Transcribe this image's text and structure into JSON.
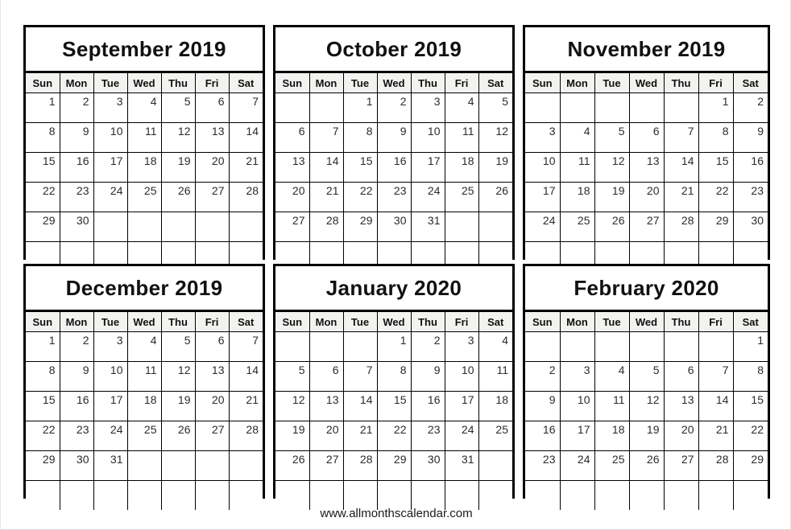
{
  "footer": {
    "url": "www.allmonthscalendar.com"
  },
  "weekday_headers": [
    "Sun",
    "Mon",
    "Tue",
    "Wed",
    "Thu",
    "Fri",
    "Sat"
  ],
  "colors": {
    "border": "#000000",
    "header_background": "#f2f2f0",
    "text": "#111111",
    "date_text": "#2b2b2b",
    "page_background": "#ffffff"
  },
  "months": [
    {
      "title": "September 2019",
      "name": "September",
      "year": "2019",
      "weeks": [
        [
          "1",
          "2",
          "3",
          "4",
          "5",
          "6",
          "7"
        ],
        [
          "8",
          "9",
          "10",
          "11",
          "12",
          "13",
          "14"
        ],
        [
          "15",
          "16",
          "17",
          "18",
          "19",
          "20",
          "21"
        ],
        [
          "22",
          "23",
          "24",
          "25",
          "26",
          "27",
          "28"
        ],
        [
          "29",
          "30",
          "",
          "",
          "",
          "",
          ""
        ],
        [
          "",
          "",
          "",
          "",
          "",
          "",
          ""
        ]
      ]
    },
    {
      "title": "October 2019",
      "name": "October",
      "year": "2019",
      "weeks": [
        [
          "",
          "",
          "1",
          "2",
          "3",
          "4",
          "5"
        ],
        [
          "6",
          "7",
          "8",
          "9",
          "10",
          "11",
          "12"
        ],
        [
          "13",
          "14",
          "15",
          "16",
          "17",
          "18",
          "19"
        ],
        [
          "20",
          "21",
          "22",
          "23",
          "24",
          "25",
          "26"
        ],
        [
          "27",
          "28",
          "29",
          "30",
          "31",
          "",
          ""
        ],
        [
          "",
          "",
          "",
          "",
          "",
          "",
          ""
        ]
      ]
    },
    {
      "title": "November 2019",
      "name": "November",
      "year": "2019",
      "weeks": [
        [
          "",
          "",
          "",
          "",
          "",
          "1",
          "2"
        ],
        [
          "3",
          "4",
          "5",
          "6",
          "7",
          "8",
          "9"
        ],
        [
          "10",
          "11",
          "12",
          "13",
          "14",
          "15",
          "16"
        ],
        [
          "17",
          "18",
          "19",
          "20",
          "21",
          "22",
          "23"
        ],
        [
          "24",
          "25",
          "26",
          "27",
          "28",
          "29",
          "30"
        ],
        [
          "",
          "",
          "",
          "",
          "",
          "",
          ""
        ]
      ]
    },
    {
      "title": "December 2019",
      "name": "December",
      "year": "2019",
      "weeks": [
        [
          "1",
          "2",
          "3",
          "4",
          "5",
          "6",
          "7"
        ],
        [
          "8",
          "9",
          "10",
          "11",
          "12",
          "13",
          "14"
        ],
        [
          "15",
          "16",
          "17",
          "18",
          "19",
          "20",
          "21"
        ],
        [
          "22",
          "23",
          "24",
          "25",
          "26",
          "27",
          "28"
        ],
        [
          "29",
          "30",
          "31",
          "",
          "",
          "",
          ""
        ],
        [
          "",
          "",
          "",
          "",
          "",
          "",
          ""
        ]
      ]
    },
    {
      "title": "January 2020",
      "name": "January",
      "year": "2020",
      "weeks": [
        [
          "",
          "",
          "",
          "1",
          "2",
          "3",
          "4"
        ],
        [
          "5",
          "6",
          "7",
          "8",
          "9",
          "10",
          "11"
        ],
        [
          "12",
          "13",
          "14",
          "15",
          "16",
          "17",
          "18"
        ],
        [
          "19",
          "20",
          "21",
          "22",
          "23",
          "24",
          "25"
        ],
        [
          "26",
          "27",
          "28",
          "29",
          "30",
          "31",
          ""
        ],
        [
          "",
          "",
          "",
          "",
          "",
          "",
          ""
        ]
      ]
    },
    {
      "title": "February 2020",
      "name": "February",
      "year": "2020",
      "weeks": [
        [
          "",
          "",
          "",
          "",
          "",
          "",
          "1"
        ],
        [
          "2",
          "3",
          "4",
          "5",
          "6",
          "7",
          "8"
        ],
        [
          "9",
          "10",
          "11",
          "12",
          "13",
          "14",
          "15"
        ],
        [
          "16",
          "17",
          "18",
          "19",
          "20",
          "21",
          "22"
        ],
        [
          "23",
          "24",
          "25",
          "26",
          "27",
          "28",
          "29"
        ],
        [
          "",
          "",
          "",
          "",
          "",
          "",
          ""
        ]
      ]
    }
  ]
}
